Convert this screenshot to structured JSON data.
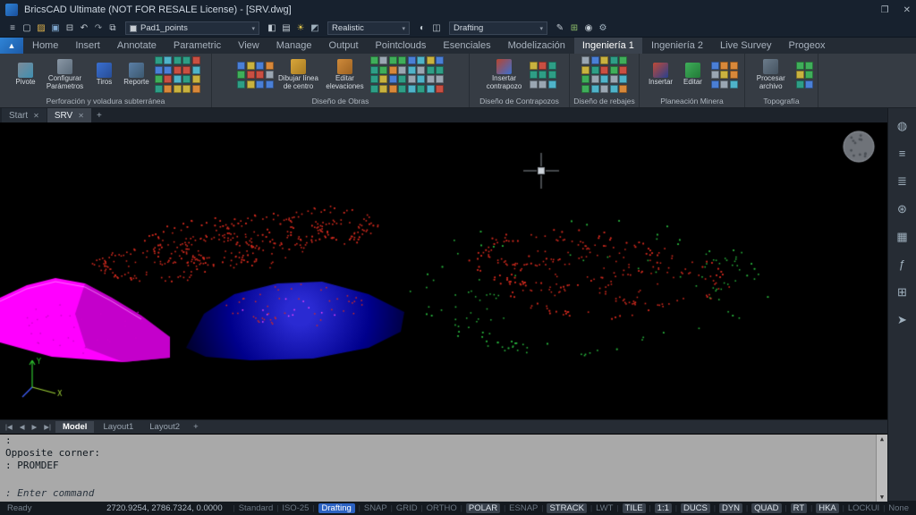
{
  "window": {
    "title": "BricsCAD Ultimate (NOT FOR RESALE License) - [SRV.dwg]",
    "restore_glyph": "❐",
    "close_glyph": "✕"
  },
  "qat": {
    "caret_glyph": "▾",
    "icons_left": [
      {
        "name": "workspaces-icon",
        "glyph": "≡",
        "color": "#c3ccd4"
      },
      {
        "name": "new-drawing-icon",
        "glyph": "▢",
        "color": "#c3ccd4"
      },
      {
        "name": "open-drawing-icon",
        "glyph": "▨",
        "color": "#e0b44c"
      },
      {
        "name": "save-icon",
        "glyph": "▣",
        "color": "#7fa8d0"
      },
      {
        "name": "print-icon",
        "glyph": "⊟",
        "color": "#c3ccd4"
      },
      {
        "name": "undo-icon",
        "glyph": "↶",
        "color": "#c3ccd4"
      },
      {
        "name": "redo-icon",
        "glyph": "↷",
        "color": "#8f99a3"
      },
      {
        "name": "copy-icon",
        "glyph": "⧉",
        "color": "#c3ccd4"
      }
    ],
    "layer_dropdown": {
      "value": "Pad1_points"
    },
    "icons_mid": [
      {
        "name": "layer-states-icon",
        "glyph": "◧",
        "color": "#c3ccd4"
      },
      {
        "name": "layers-panel-icon",
        "glyph": "▤",
        "color": "#c3ccd4"
      },
      {
        "name": "sun-icon",
        "glyph": "☀",
        "color": "#e0c44c"
      },
      {
        "name": "materials-icon",
        "glyph": "◩",
        "color": "#9fb0bd"
      }
    ],
    "visual_style_dropdown": {
      "value": "Realistic"
    },
    "icons_mid2": [
      {
        "name": "render-icon",
        "glyph": "◐",
        "color": "#c3ccd4"
      },
      {
        "name": "view-settings-icon",
        "glyph": "◫",
        "color": "#c3ccd4"
      }
    ],
    "workspace_dropdown": {
      "value": "Drafting"
    },
    "icons_right": [
      {
        "name": "annotate-icon",
        "glyph": "✎",
        "color": "#c3ccd4"
      },
      {
        "name": "section-icon",
        "glyph": "⊞",
        "color": "#8fc06a"
      },
      {
        "name": "camera-icon",
        "glyph": "◉",
        "color": "#c3ccd4"
      },
      {
        "name": "settings-icon",
        "glyph": "⚙",
        "color": "#9fb0bd"
      }
    ]
  },
  "ribbon": {
    "app_glyph": "▲",
    "tabs": [
      {
        "label": "Home"
      },
      {
        "label": "Insert"
      },
      {
        "label": "Annotate"
      },
      {
        "label": "Parametric"
      },
      {
        "label": "View"
      },
      {
        "label": "Manage"
      },
      {
        "label": "Output"
      },
      {
        "label": "Pointclouds"
      },
      {
        "label": "Esenciales"
      },
      {
        "label": "Modelización"
      },
      {
        "label": "Ingeniería 1",
        "active": true
      },
      {
        "label": "Ingeniería 2"
      },
      {
        "label": "Live Survey"
      },
      {
        "label": "Progeox"
      }
    ],
    "icon_palette": [
      "#4fb3c9",
      "#3fae5a",
      "#d8883a",
      "#4a7fd6",
      "#c94f42",
      "#9aa6b2",
      "#2e9e86",
      "#c9b23f"
    ],
    "groups": [
      {
        "title": "Perforación y voladura subterránea",
        "buttons": [
          "Pivote",
          "Configurar Parámetros",
          "Tiros",
          "Reporte"
        ]
      },
      {
        "title": "Diseño de Obras",
        "buttons": [
          "Dibujar línea de centro",
          "Editar elevaciones"
        ]
      },
      {
        "title": "Diseño de Contrapozos",
        "buttons": [
          "Insertar contrapozo"
        ]
      },
      {
        "title": "Diseño de rebajes",
        "buttons": []
      },
      {
        "title": "Planeación Minera",
        "buttons": [
          "Insertar",
          "Editar"
        ]
      },
      {
        "title": "Topografía",
        "buttons": [
          "Procesar archivo"
        ]
      }
    ]
  },
  "doc_tabs": {
    "close_glyph": "✕",
    "add_label": "+",
    "tabs": [
      {
        "label": "Start"
      },
      {
        "label": "SRV",
        "active": true
      }
    ]
  },
  "layout_tabs": {
    "nav": [
      "|◀",
      "◀",
      "▶",
      "▶|"
    ],
    "add_label": "+",
    "tabs": [
      {
        "label": "Model",
        "active": true
      },
      {
        "label": "Layout1"
      },
      {
        "label": "Layout2"
      }
    ]
  },
  "command": {
    "lines": [
      ":",
      "Opposite corner:",
      ": PROMDEF"
    ],
    "prompt": ": Enter command",
    "scroll_up_glyph": "▲",
    "scroll_down_glyph": "▼"
  },
  "sidebar": {
    "icons": [
      {
        "name": "light-icon",
        "glyph": "◍",
        "color": "#9fb0bd"
      },
      {
        "name": "filter-sliders-icon",
        "glyph": "≡",
        "color": "#9fb0bd"
      },
      {
        "name": "layers-icon",
        "glyph": "≣",
        "color": "#9fb0bd"
      },
      {
        "name": "attachments-icon",
        "glyph": "⊛",
        "color": "#9fb0bd"
      },
      {
        "name": "sheet-sets-icon",
        "glyph": "▦",
        "color": "#9fb0bd"
      },
      {
        "name": "fx-icon",
        "glyph": "ƒ",
        "color": "#9fb0bd"
      },
      {
        "name": "reports-icon",
        "glyph": "⊞",
        "color": "#9fb0bd"
      },
      {
        "name": "export-icon",
        "glyph": "➤",
        "color": "#9fb0bd"
      }
    ]
  },
  "status": {
    "ready": "Ready",
    "coords": "2720.9254, 2786.7324, 0.0000",
    "separator": "|",
    "items": [
      {
        "label": "Standard",
        "active": false
      },
      {
        "label": "ISO-25",
        "active": false
      },
      {
        "label": "Drafting",
        "style": "accent"
      },
      {
        "label": "SNAP",
        "active": false
      },
      {
        "label": "GRID",
        "active": false
      },
      {
        "label": "ORTHO",
        "active": false
      },
      {
        "label": "POLAR",
        "active": true
      },
      {
        "label": "ESNAP",
        "active": false
      },
      {
        "label": "STRACK",
        "active": true
      },
      {
        "label": "LWT",
        "active": false
      },
      {
        "label": "TILE",
        "active": true
      },
      {
        "label": "1:1",
        "active": true
      },
      {
        "label": "DUCS",
        "active": true
      },
      {
        "label": "DYN",
        "active": true
      },
      {
        "label": "QUAD",
        "active": true
      },
      {
        "label": "RT",
        "active": true
      },
      {
        "label": "HKA",
        "active": true
      },
      {
        "label": "LOCKUI",
        "active": false
      },
      {
        "label": "None",
        "active": false
      }
    ]
  },
  "viewport": {
    "colors": {
      "bg": "#000000",
      "point_red": "#d42a1e",
      "point_green": "#27b43c",
      "terrain_magenta": "#ff00ff",
      "terrain_blue_hi": "#2a2ad2",
      "terrain_blue": "#00008c",
      "terrain_blue_dark": "#000030",
      "crosshair": "#8a9096",
      "ucs_x": "#9ccf35",
      "ucs_y": "#2fc42f",
      "ucs_z": "#4060ff",
      "compass": "#82878e"
    }
  }
}
